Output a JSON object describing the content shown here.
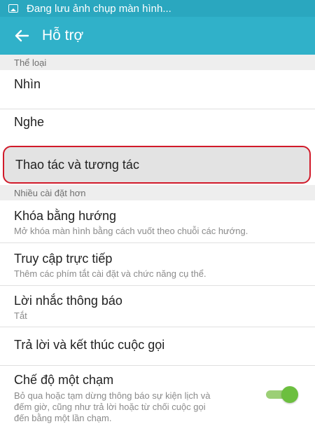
{
  "status_bar": {
    "icon": "screenshot-icon",
    "text": "Đang lưu ảnh chụp màn hình..."
  },
  "app_bar": {
    "back_icon": "arrow-left-icon",
    "title": "Hỗ trợ"
  },
  "sections": {
    "category": "Thể loại",
    "more_settings": "Nhiều cài đặt hơn"
  },
  "items": {
    "vision": {
      "title": "Nhìn"
    },
    "hearing": {
      "title": "Nghe"
    },
    "dexterity": {
      "title": "Thao tác và tương tác"
    },
    "direction_lock": {
      "title": "Khóa bằng hướng",
      "sub": "Mở khóa màn hình bằng cách vuốt theo chuỗi các hướng."
    },
    "direct_access": {
      "title": "Truy cập trực tiếp",
      "sub": "Thêm các phím tắt cài đặt và chức năng cụ thể."
    },
    "notification_reminder": {
      "title": "Lời nhắc thông báo",
      "sub": "Tắt"
    },
    "answer_end_calls": {
      "title": "Trả lời và kết thúc cuộc gọi"
    },
    "single_tap": {
      "title": "Chế độ một chạm",
      "sub1": "Bỏ qua hoặc tạm dừng thông báo sự kiện lịch và",
      "sub2": "đếm giờ, cũng như trả lời hoặc từ chối cuộc gọi",
      "sub3": "đến bằng một lần chạm.",
      "toggle_on": true
    }
  },
  "colors": {
    "status_bar": "#2aa7bf",
    "app_bar": "#30b1c9",
    "highlight_border": "#d11a2a",
    "toggle_on": "#6cbf3f"
  }
}
